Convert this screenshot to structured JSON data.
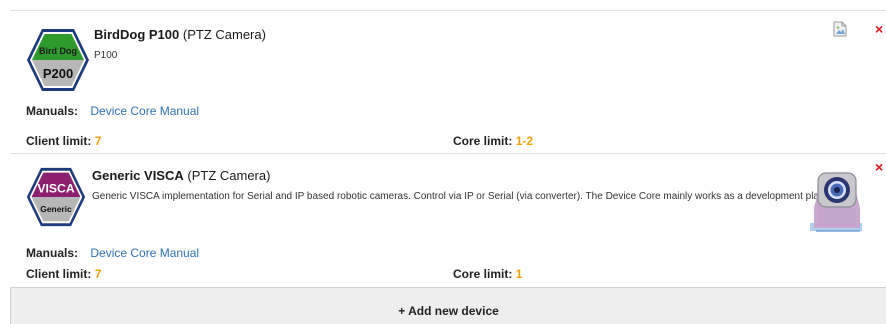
{
  "devices": [
    {
      "name": "BirdDog P100",
      "type": "(PTZ Camera)",
      "description": "P100",
      "badge_top": "Bird Dog",
      "badge_bottom": "P200",
      "badge_top_color": "#2e9a2e",
      "manuals_label": "Manuals:",
      "manual_link": "Device Core Manual",
      "client_limit_label": "Client limit:",
      "client_limit_value": "7",
      "core_limit_label": "Core limit:",
      "core_limit_value": "1-2",
      "remove_icon": "×"
    },
    {
      "name": "Generic VISCA",
      "type": "(PTZ Camera)",
      "description": "Generic VISCA implementation for Serial and IP based robotic cameras. Control via IP or Serial (via converter). The Device Core mainly works as a development platform.",
      "badge_top": "VISCA",
      "badge_bottom": "Generic",
      "badge_top_color": "#8c1f6e",
      "manuals_label": "Manuals:",
      "manual_link": "Device Core Manual",
      "client_limit_label": "Client limit:",
      "client_limit_value": "7",
      "core_limit_label": "Core limit:",
      "core_limit_value": "1",
      "remove_icon": "×"
    }
  ],
  "add_device_label": "+ Add new device",
  "colors": {
    "link": "#2f72b4",
    "limit_value": "#f0a00a",
    "remove": "#d9141b"
  }
}
